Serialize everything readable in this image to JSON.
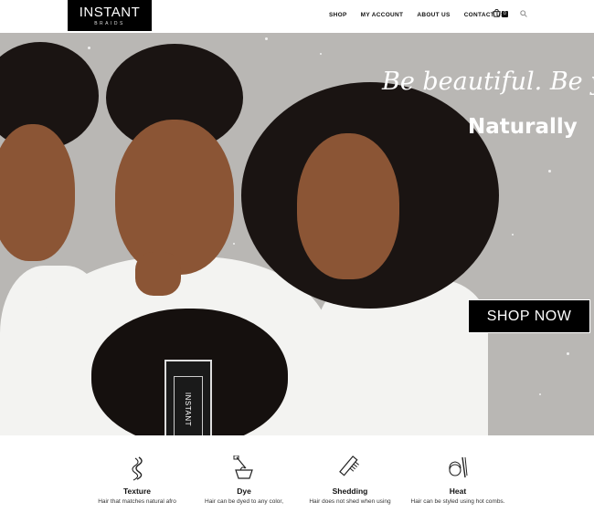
{
  "header": {
    "logo_main": "INSTANT",
    "logo_sub": "BRAIDS",
    "nav": [
      "SHOP",
      "MY ACCOUNT",
      "ABOUT US",
      "CONTACT US"
    ],
    "cart_count": "0",
    "icons": {
      "cart": "cart-icon",
      "search": "search-icon"
    }
  },
  "hero": {
    "tagline_script": "Be beautiful. Be you,",
    "tagline_bold": "Naturally",
    "cta_label": "SHOP NOW",
    "tag_text": "INSTANT"
  },
  "features": [
    {
      "title": "Texture",
      "desc": "Hair that matches natural afro",
      "icon": "braid-icon"
    },
    {
      "title": "Dye",
      "desc": "Hair can be dyed to any color,",
      "icon": "dye-bowl-icon"
    },
    {
      "title": "Shedding",
      "desc": "Hair does not shed when using",
      "icon": "comb-icon"
    },
    {
      "title": "Heat",
      "desc": "Hair can be styled using hot combs.",
      "icon": "flat-iron-icon"
    }
  ],
  "colors": {
    "accent": "#000000",
    "hero_bg": "#b9b7b4",
    "text_light": "#ffffff"
  }
}
